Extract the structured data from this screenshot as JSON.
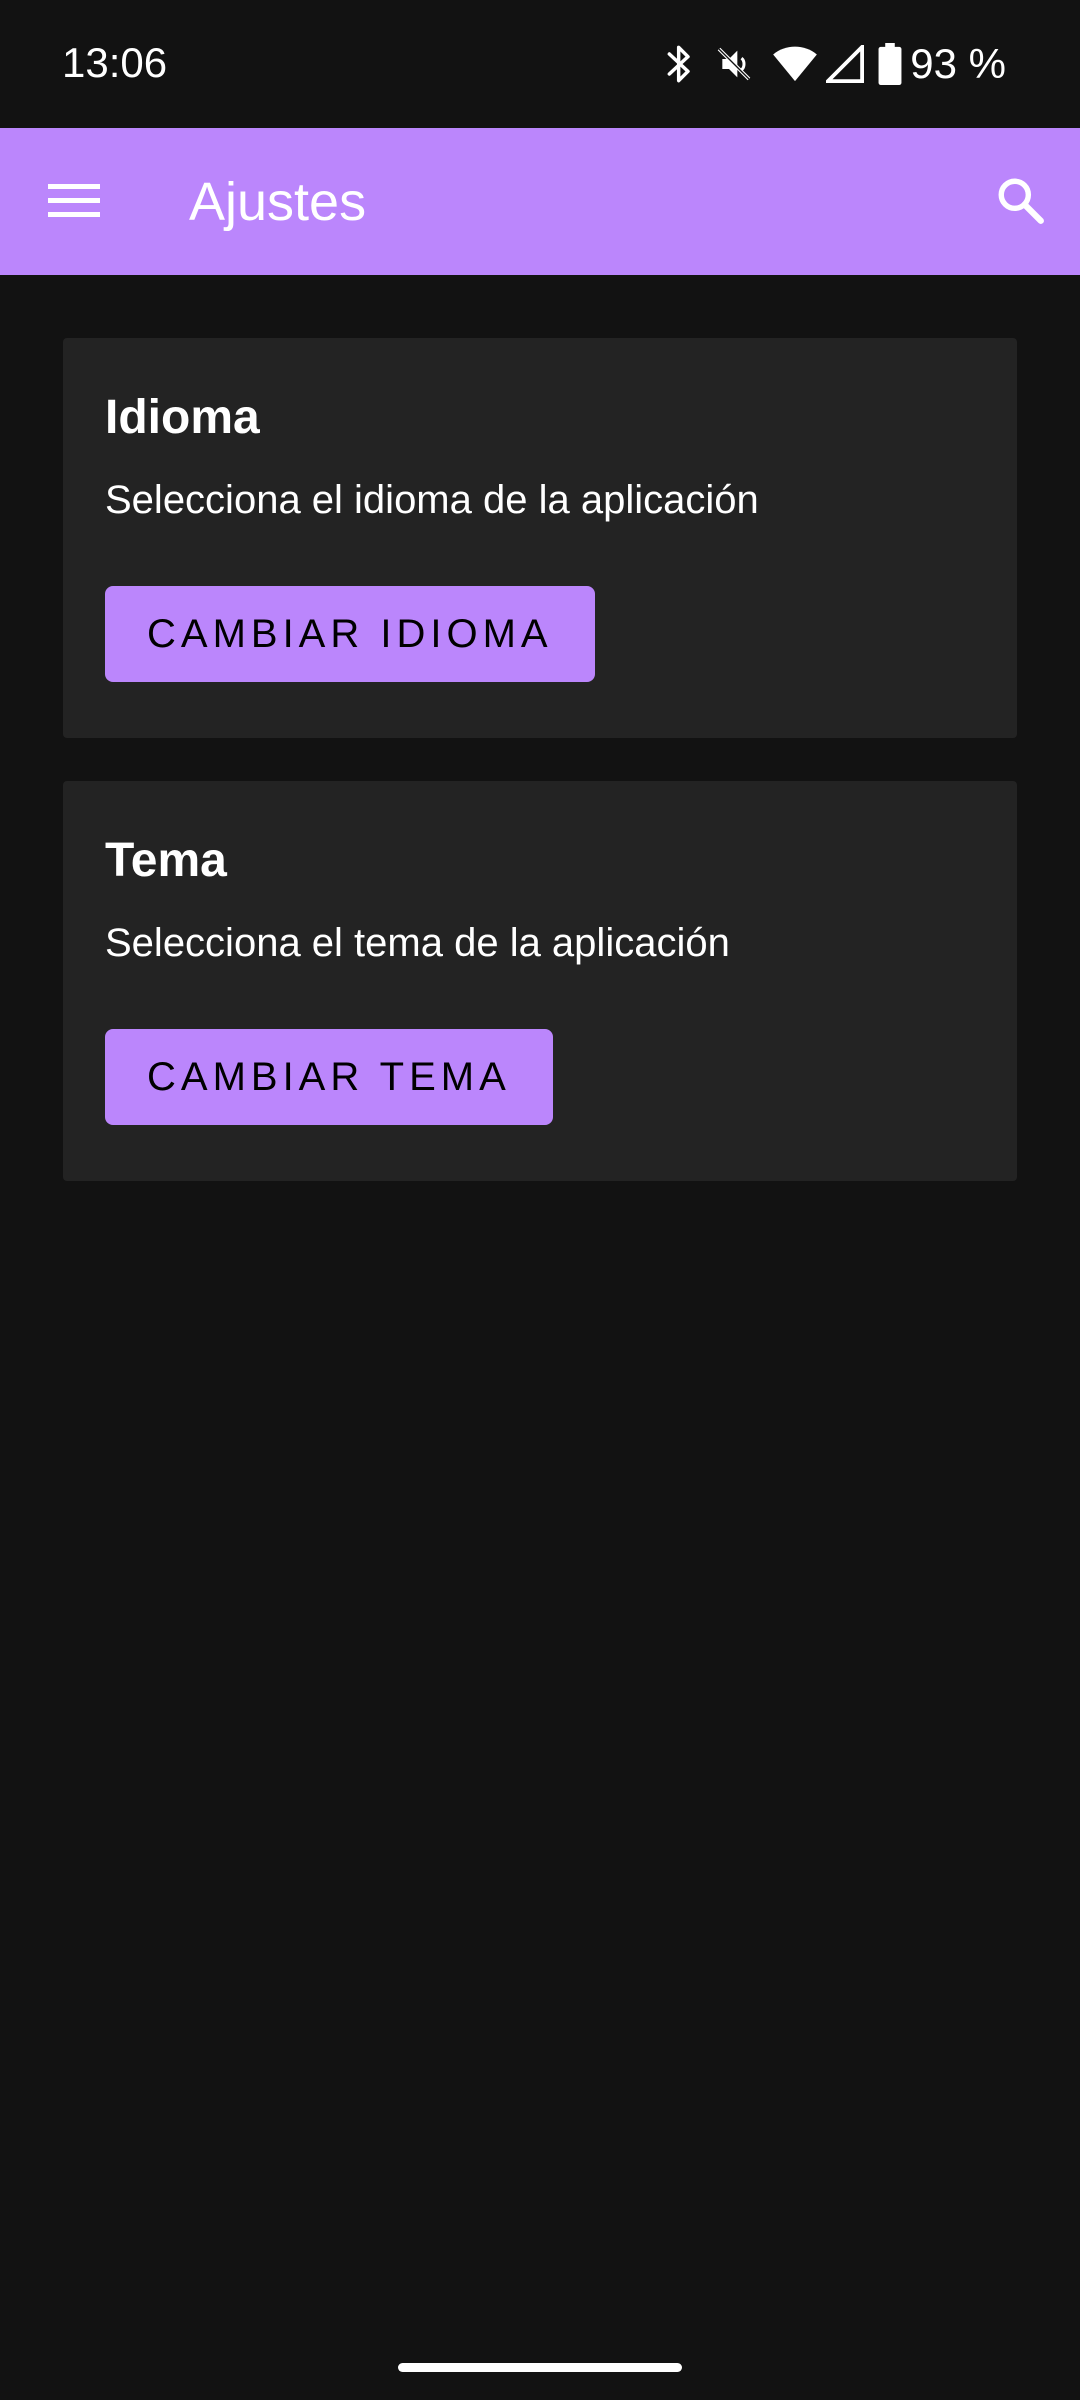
{
  "status_bar": {
    "time": "13:06",
    "battery_text": "93 %",
    "icons": [
      "bluetooth-icon",
      "vibrate-off-icon",
      "wifi-icon",
      "signal-icon",
      "battery-icon"
    ]
  },
  "app_bar": {
    "title": "Ajustes",
    "menu_icon": "hamburger-menu-icon",
    "search_icon": "search-icon",
    "color": "#bb86fc"
  },
  "settings": {
    "language": {
      "title": "Idioma",
      "description": "Selecciona el idioma de la aplicación",
      "button_label": "CAMBIAR IDIOMA"
    },
    "theme": {
      "title": "Tema",
      "description": "Selecciona el tema de la aplicación",
      "button_label": "CAMBIAR TEMA"
    }
  },
  "colors": {
    "background": "#121212",
    "card": "#232323",
    "accent": "#bb86fc"
  }
}
